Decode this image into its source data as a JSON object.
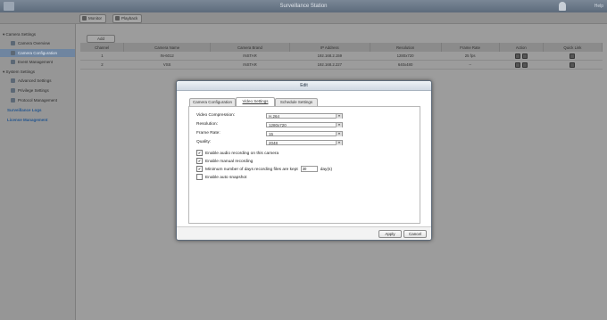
{
  "app": {
    "title": "Surveillance Station",
    "help_label": "Help"
  },
  "toolbar": {
    "monitor_label": "Monitor",
    "playback_label": "Playback"
  },
  "sidebar": {
    "items": [
      {
        "label": "Camera Settings"
      },
      {
        "label": "Camera Overview"
      },
      {
        "label": "Camera Configuration"
      },
      {
        "label": "Event Management"
      },
      {
        "label": "System Settings"
      },
      {
        "label": "Advanced Settings"
      },
      {
        "label": "Privilege Settings"
      },
      {
        "label": "Protocol Management"
      },
      {
        "label": "Surveillance Logs"
      },
      {
        "label": "License Management"
      }
    ]
  },
  "main": {
    "add_label": "Add",
    "table": {
      "headers": [
        "Channel",
        "Camera Name",
        "Camera Brand",
        "IP Address",
        "Resolution",
        "Frame Rate",
        "Action",
        "Quick Link"
      ],
      "rows": [
        [
          "1",
          "IN-6012",
          "INSTAR",
          "192.168.2.159",
          "1280x720",
          "25 fps"
        ],
        [
          "2",
          "VSS",
          "INSTAR",
          "192.168.2.227",
          "640x480",
          "--"
        ]
      ]
    }
  },
  "dialog": {
    "title": "Edit",
    "tabs": [
      "Camera Configuration",
      "Video Settings",
      "Schedule Settings"
    ],
    "fields": {
      "compression_label": "Video Compression:",
      "compression_value": "H.264",
      "resolution_label": "Resolution:",
      "resolution_value": "1280x720",
      "framerate_label": "Frame Rate:",
      "framerate_value": "15",
      "quality_label": "Quality:",
      "quality_value": "2048"
    },
    "checkboxes": {
      "audio": "Enable audio recording on this camera",
      "manual": "Enable manual recording",
      "min_days": "Minimum number of days recording files are kept",
      "days_value": "30",
      "days_unit": "day(s)",
      "snapshot": "Enable auto snapshot"
    },
    "apply_label": "Apply",
    "cancel_label": "Cancel"
  }
}
